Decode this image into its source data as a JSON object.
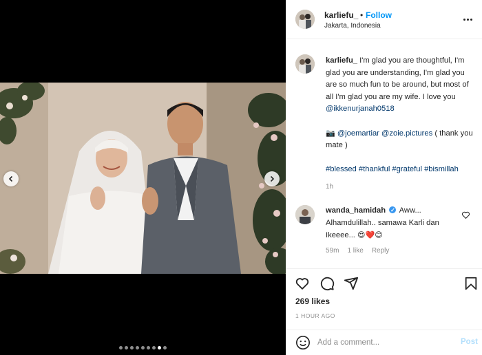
{
  "post": {
    "username": "karliefu_",
    "separator": "•",
    "follow_label": "Follow",
    "location": "Jakarta, Indonesia",
    "more_icon": "more-horizontal-icon"
  },
  "media": {
    "prev_icon": "chevron-left-icon",
    "next_icon": "chevron-right-icon",
    "carousel_count": 9,
    "carousel_active_index": 7
  },
  "caption": {
    "username": "karliefu_",
    "text": "I'm glad you are thoughtful, I'm glad you are understanding, I'm glad you are so much fun to be around, but most of all I'm glad you are my wife. I love you",
    "mention": "@ikkenurjanah0518",
    "credit_icon": "📷",
    "credit_mention_1": "@joemartiar",
    "credit_mention_2": "@zoie.pictures",
    "credit_text": "( thank you mate )",
    "tag_1": "#blessed",
    "tag_2": "#thankful",
    "tag_3": "#grateful",
    "tag_4": "#bismillah",
    "time": "1h"
  },
  "comment": {
    "username": "wanda_hamidah",
    "text": "Aww... Alhamdulillah.. samawa Karli dan Ikeeee...",
    "emojis": "😍❤️😊",
    "time": "59m",
    "likes": "1 like",
    "reply_label": "Reply"
  },
  "actions": {
    "likes": "269 likes",
    "time_ago": "1 HOUR AGO"
  },
  "add_comment": {
    "placeholder": "Add a comment...",
    "post_label": "Post"
  },
  "colors": {
    "link": "#00376b",
    "follow": "#0095f6",
    "muted": "#8e8e8e",
    "post_disabled": "#b2dffc"
  }
}
